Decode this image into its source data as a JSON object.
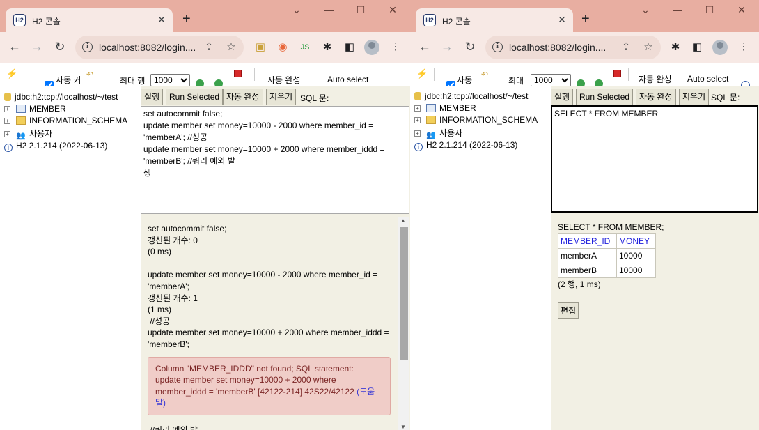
{
  "browser": {
    "tab_title": "H2 콘솔",
    "favicon": "H2",
    "new_tab": "+",
    "url": "localhost:8082/login....",
    "url_short": "localhost:8082/login...."
  },
  "h2": {
    "toolbar": {
      "autocommit_label_left": "자동 커",
      "autocommit_label_right": "자동",
      "maxrows_label_left": "최대 행",
      "maxrows_label_right": "최대",
      "maxrows_value": "1000",
      "autocomplete_label": "자동 완성",
      "autoselect_label": "Auto select"
    },
    "tree": {
      "connection": "jdbc:h2:tcp://localhost/~/test",
      "items": [
        "MEMBER",
        "INFORMATION_SCHEMA",
        "사용자"
      ],
      "version": "H2 2.1.214 (2022-06-13)"
    },
    "buttons": {
      "run": "실행",
      "run_selected": "Run Selected",
      "autocomplete": "자동 완성",
      "clear": "지우기",
      "sql_label": "SQL 문:"
    }
  },
  "left": {
    "sql_text": "set autocommit false;\nupdate member set money=10000 - 2000 where member_id = 'memberA'; //성공\nupdate member set money=10000 + 2000 where member_iddd = 'memberB'; //쿼리 예외 발\n생",
    "output": {
      "q1": "set autocommit false;",
      "q1_count": "갱신된 개수: 0",
      "q1_time": "(0 ms)",
      "q2": "update member set money=10000 - 2000 where member_id = 'memberA';",
      "q2_count": "갱신된 개수: 1",
      "q2_time": "(1 ms)",
      "q2_comment": " //성공",
      "q3": "update member set money=10000 + 2000 where member_iddd = 'memberB';",
      "error": "Column \"MEMBER_IDDD\" not found; SQL statement:\nupdate member set money=10000 + 2000 where member_iddd = 'memberB' [42122-214] 42S22/42122 ",
      "error_help": "(도움말)",
      "trailing": " //쿼리 예외 발"
    }
  },
  "right": {
    "sql_text": "SELECT * FROM MEMBER",
    "result_query": "SELECT * FROM MEMBER;",
    "columns": [
      "MEMBER_ID",
      "MONEY"
    ],
    "rows": [
      [
        "memberA",
        "10000"
      ],
      [
        "memberB",
        "10000"
      ]
    ],
    "summary": "(2 행, 1 ms)",
    "edit_button": "편집"
  },
  "colors": {
    "tabbar": "#e8aea1",
    "toolbar": "#f7e9e5",
    "result_bg": "#f2f0e4",
    "error_bg": "#f0cdc8",
    "header_link": "#2222dd"
  }
}
